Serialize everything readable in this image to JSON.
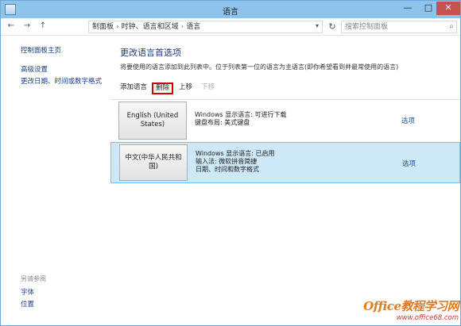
{
  "window": {
    "title": "语言"
  },
  "titlebar": {
    "min": "—",
    "max": "□",
    "close": "✕"
  },
  "addressbar": {
    "back": "←",
    "forward": "→",
    "up": "↑",
    "crumbs": [
      "制面板",
      "时钟、语言和区域",
      "语言"
    ],
    "search_placeholder": "搜索控制面板"
  },
  "leftpane": {
    "home": "控制面板主页",
    "advanced": "高级设置",
    "date_formats": "更改日期、时间或数字格式",
    "see_also": "另请参阅",
    "fonts": "字体",
    "location": "位置"
  },
  "main": {
    "heading": "更改语言首选项",
    "description": "将要使用的语言添加到此列表中。位于列表第一位的语言为主语言(即你希望看到并最常使用的语言)",
    "toolbar": {
      "add": "添加语言",
      "delete": "删除",
      "up": "上移",
      "down": "下移"
    },
    "languages": [
      {
        "name": "English (United States)",
        "line1": "Windows 显示语言: 可进行下载",
        "line2": "键盘布局: 美式键盘",
        "line3": "",
        "options": "选项"
      },
      {
        "name": "中文(中华人民共和国)",
        "line1": "Windows 显示语言: 已启用",
        "line2": "输入法: 微软拼音简捷",
        "line3": "日期、时间和数字格式",
        "options": "选项"
      }
    ]
  },
  "watermark": {
    "main": "Office教程学习网",
    "url": "www.office68.com"
  }
}
